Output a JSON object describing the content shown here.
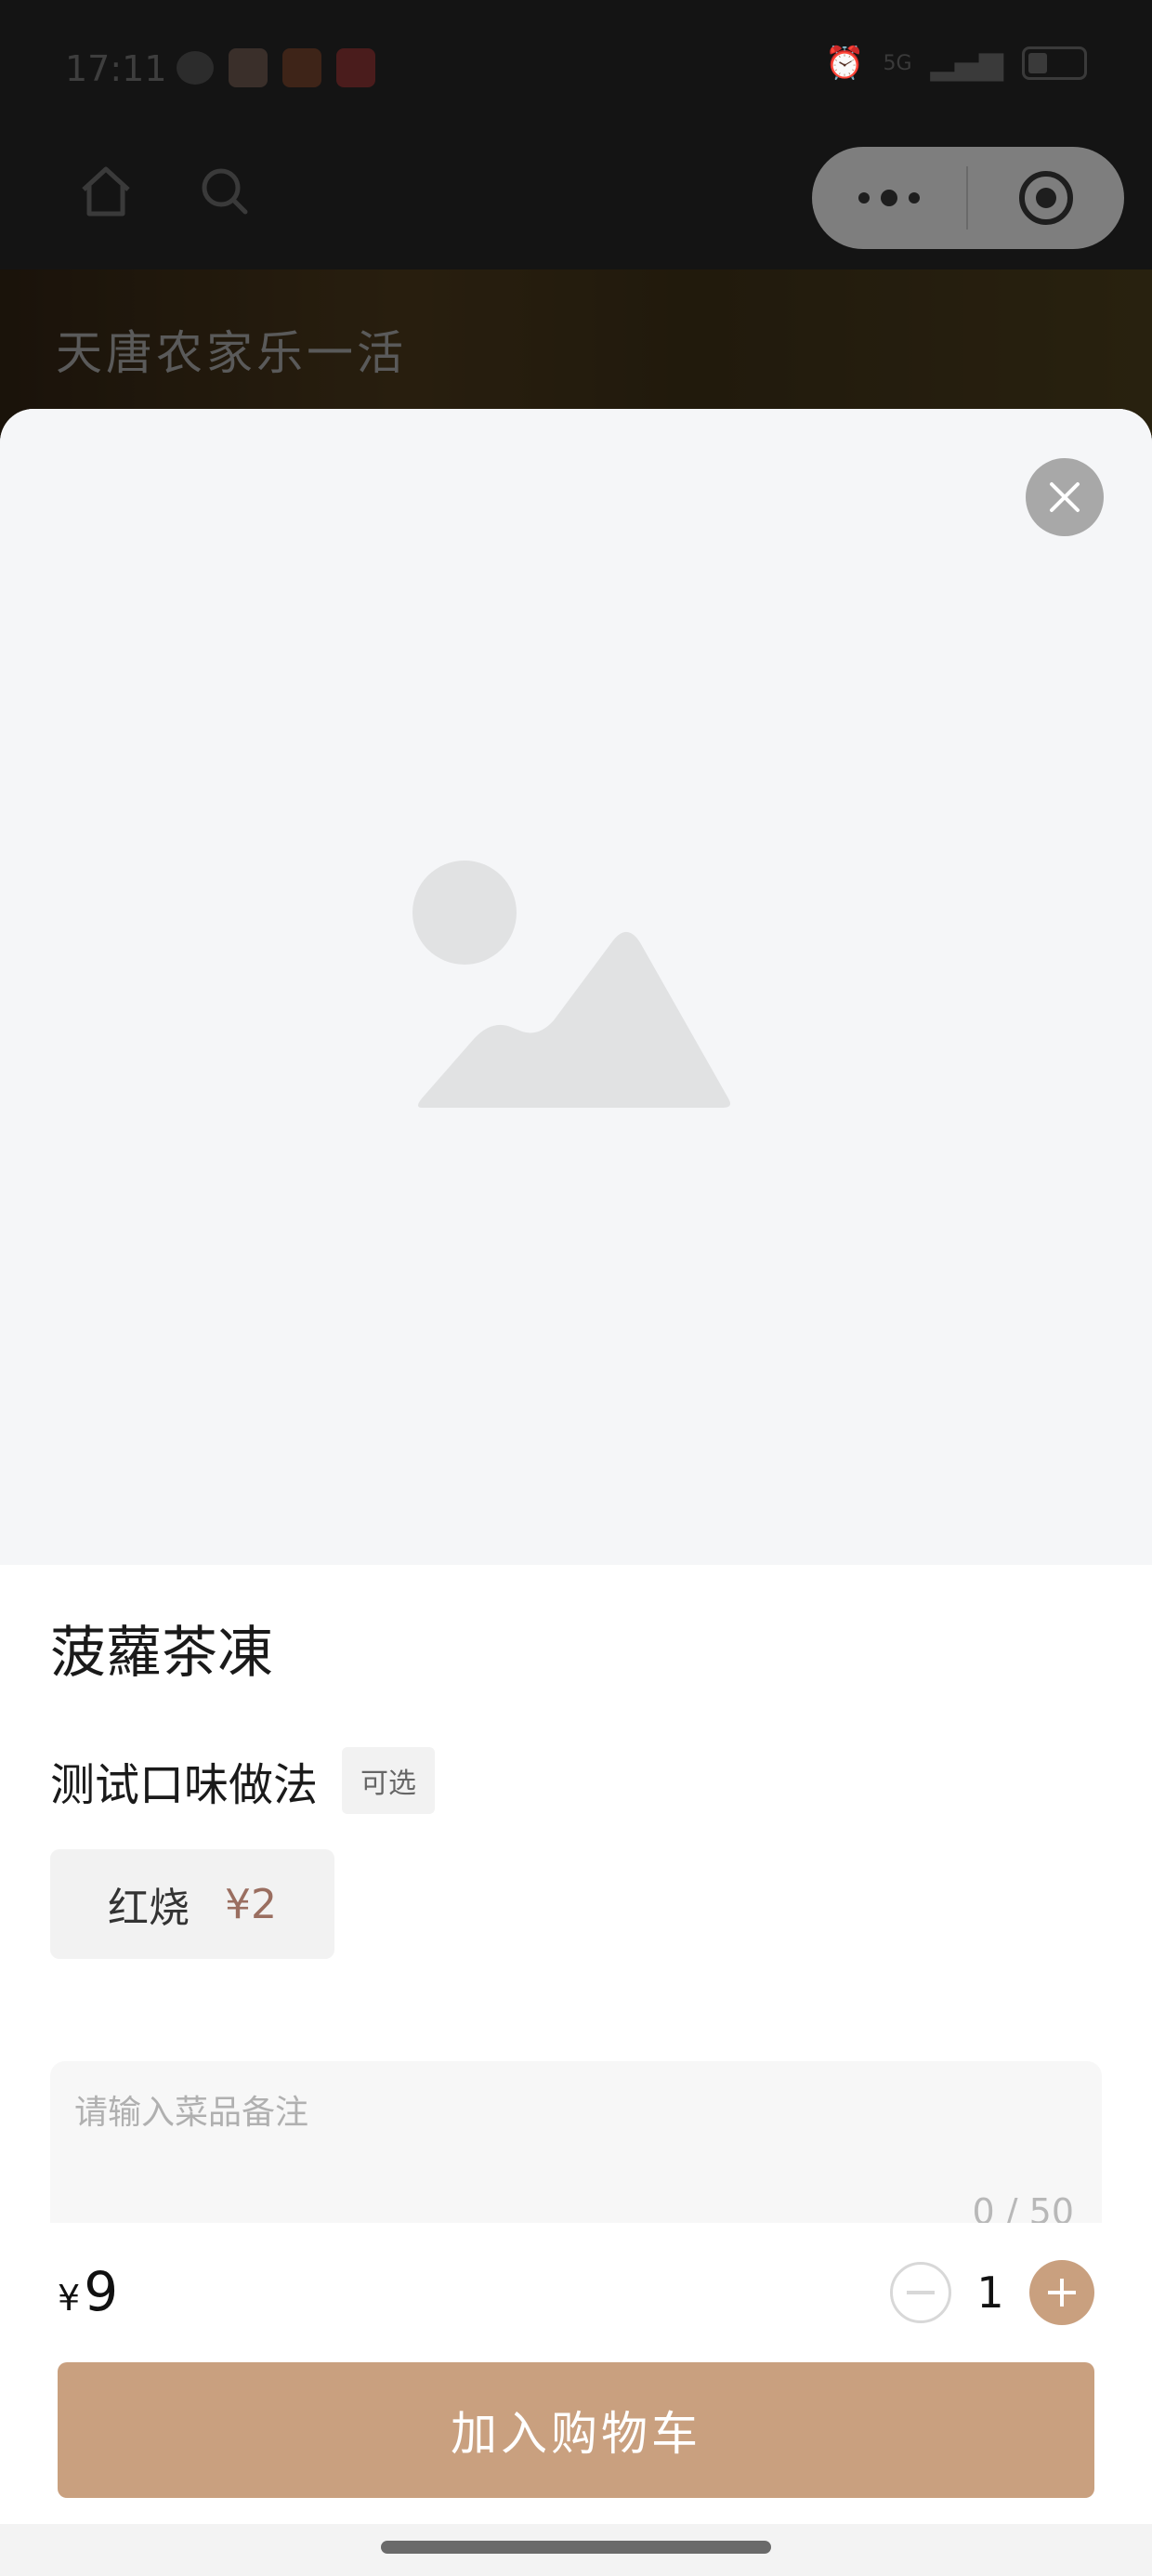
{
  "status_bar": {
    "time": "17:11",
    "app_icons": [
      "wechat-icon",
      "game-icon",
      "food-app-icon",
      "toutiao-icon"
    ],
    "signal_label": "5G",
    "battery_level": "6"
  },
  "background_page": {
    "banner_title": "天唐农家乐一活"
  },
  "product": {
    "name": "菠蘿茶凍",
    "option_group_title": "测试口味做法",
    "option_group_tag": "可选",
    "options": [
      {
        "name": "红烧",
        "price": "¥2"
      }
    ],
    "remark": {
      "placeholder": "请输入菜品备注",
      "count": "0 / 50"
    }
  },
  "footer": {
    "currency": "¥",
    "total": "9",
    "quantity": "1",
    "add_to_cart_label": "加入购物车"
  },
  "colors": {
    "accent": "#c9a07f",
    "option_price": "#9a6e60",
    "image_placeholder_bg": "#f5f6f8"
  }
}
